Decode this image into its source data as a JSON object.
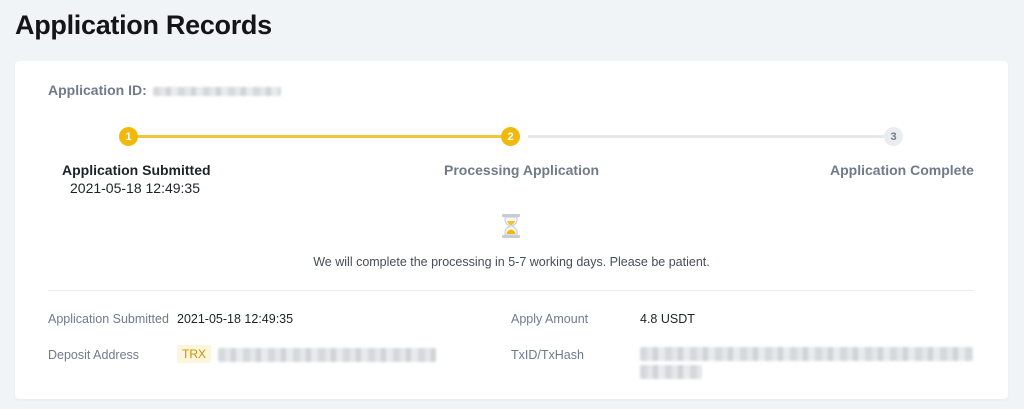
{
  "page": {
    "title": "Application Records"
  },
  "application": {
    "id_label": "Application ID:"
  },
  "steps": [
    {
      "number": "1",
      "label": "Application Submitted",
      "time": "2021-05-18 12:49:35",
      "state": "done"
    },
    {
      "number": "2",
      "label": "Processing Application",
      "state": "active"
    },
    {
      "number": "3",
      "label": "Application Complete",
      "state": "pending"
    }
  ],
  "status": {
    "icon": "hourglass-icon",
    "message": "We will complete the processing in 5-7 working days. Please be patient."
  },
  "details": {
    "submitted_label": "Application Submitted",
    "submitted_value": "2021-05-18 12:49:35",
    "amount_label": "Apply Amount",
    "amount_value": "4.8 USDT",
    "deposit_label": "Deposit Address",
    "network": "TRX",
    "txid_label": "TxID/TxHash"
  },
  "colors": {
    "accent": "#f0b90b",
    "progress_line": "#f0c63a",
    "inactive": "#eaecef",
    "background": "#f1f4f6"
  }
}
